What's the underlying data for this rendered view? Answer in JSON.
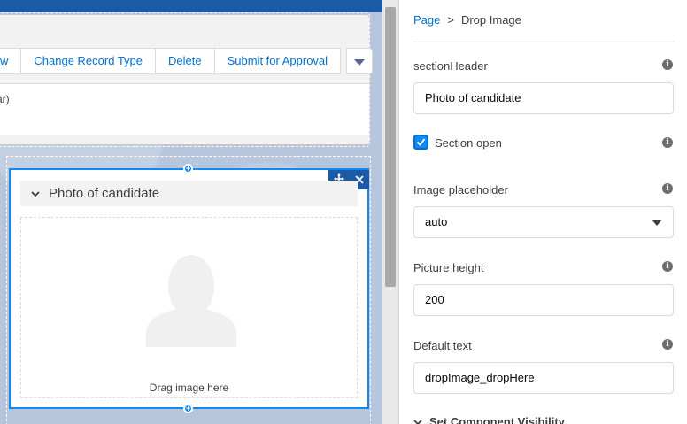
{
  "canvas": {
    "record_actions": [
      "w",
      "Change Record Type",
      "Delete",
      "Submit for Approval"
    ],
    "record_body_text": "ar)",
    "component": {
      "section_title": "Photo of candidate",
      "drop_label": "Drag image here"
    }
  },
  "panel": {
    "breadcrumb": {
      "root": "Page",
      "separator": ">",
      "current": "Drop Image"
    },
    "section_header": {
      "label": "sectionHeader",
      "value": "Photo of candidate"
    },
    "section_open": {
      "label": "Section open",
      "checked": true
    },
    "image_placeholder": {
      "label": "Image placeholder",
      "value": "auto"
    },
    "picture_height": {
      "label": "Picture height",
      "value": "200"
    },
    "default_text": {
      "label": "Default text",
      "value": "dropImage_dropHere"
    },
    "visibility_section": "Set Component Visibility"
  },
  "colors": {
    "brand_blue": "#0070d2",
    "selection_blue": "#1589ee",
    "canvas_background": "#b7c6dc"
  },
  "icons": [
    "chevron-down-icon",
    "move-icon",
    "close-icon",
    "add-icon",
    "info-icon",
    "avatar-placeholder-icon",
    "check-icon",
    "caret-down-icon"
  ]
}
